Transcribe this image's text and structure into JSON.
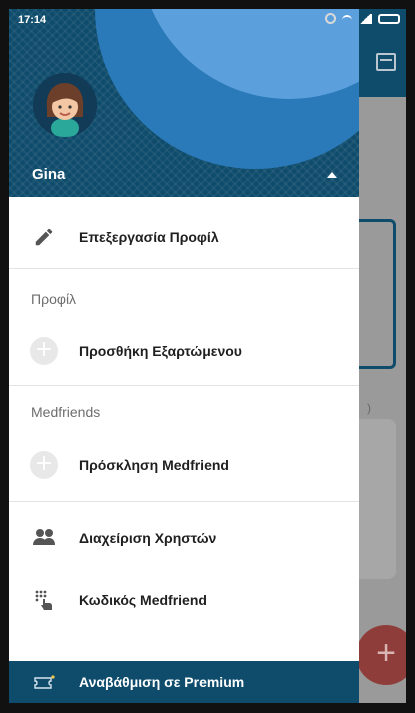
{
  "status_bar": {
    "time": "17:14"
  },
  "drawer": {
    "user_name": "Gina",
    "edit_profile": "Επεξεργασία Προφίλ",
    "profile_section": {
      "header": "Προφίλ",
      "add_dependent": "Προσθήκη Εξαρτώμενου"
    },
    "medfriends_section": {
      "header": "Medfriends",
      "invite": "Πρόσκληση Medfriend"
    },
    "manage_users": "Διαχείριση Χρηστών",
    "medfriend_code": "Κωδικός Medfriend",
    "upgrade_premium": "Αναβάθμιση σε Premium"
  },
  "background_app": {
    "fab_symbol": "+",
    "paren_text": ")"
  },
  "colors": {
    "primary": "#0f4c6c",
    "accent_circle": "#5b9fdc",
    "fab": "#8f3d3a"
  }
}
